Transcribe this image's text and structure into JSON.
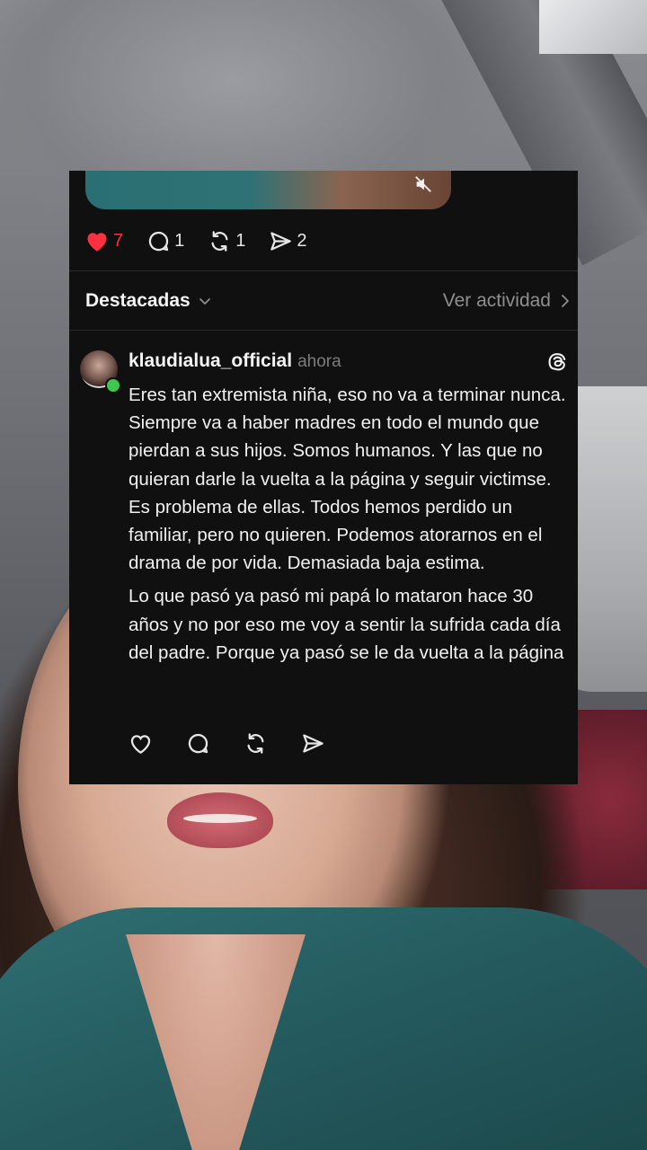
{
  "post": {
    "actions": [
      {
        "name": "like",
        "count": "7",
        "liked": true
      },
      {
        "name": "reply",
        "count": "1"
      },
      {
        "name": "repost",
        "count": "1"
      },
      {
        "name": "share",
        "count": "2"
      }
    ]
  },
  "replies_header": {
    "sort_label": "Destacadas",
    "activity_label": "Ver actividad"
  },
  "comment": {
    "username": "klaudialua_official",
    "time": "ahora",
    "paragraph_1": "Eres tan extremista niña, eso no va a terminar nunca. Siempre va a haber madres en todo el mundo que pierdan a sus hijos. Somos humanos. Y las que no quieran darle la vuelta a la página y seguir victimse. Es problema de ellas. Todos hemos perdido un familiar, pero no quieren. Podemos atorarnos en el drama de por vida. Demasiada baja estima.",
    "paragraph_2": "Lo que pasó ya pasó mi papá lo mataron hace 30 años y no por eso me voy a sentir la sufrida cada día del padre. Porque ya pasó se le da vuelta a la página"
  },
  "colors": {
    "card_bg": "#101010",
    "like_red": "#ff3040",
    "muted_text": "#8e8e8e",
    "online_green": "#3ec84d"
  },
  "icons": [
    "heart-icon",
    "reply-icon",
    "repost-icon",
    "share-icon",
    "chevron-down-icon",
    "chevron-right-icon",
    "threads-icon",
    "mute-icon"
  ]
}
